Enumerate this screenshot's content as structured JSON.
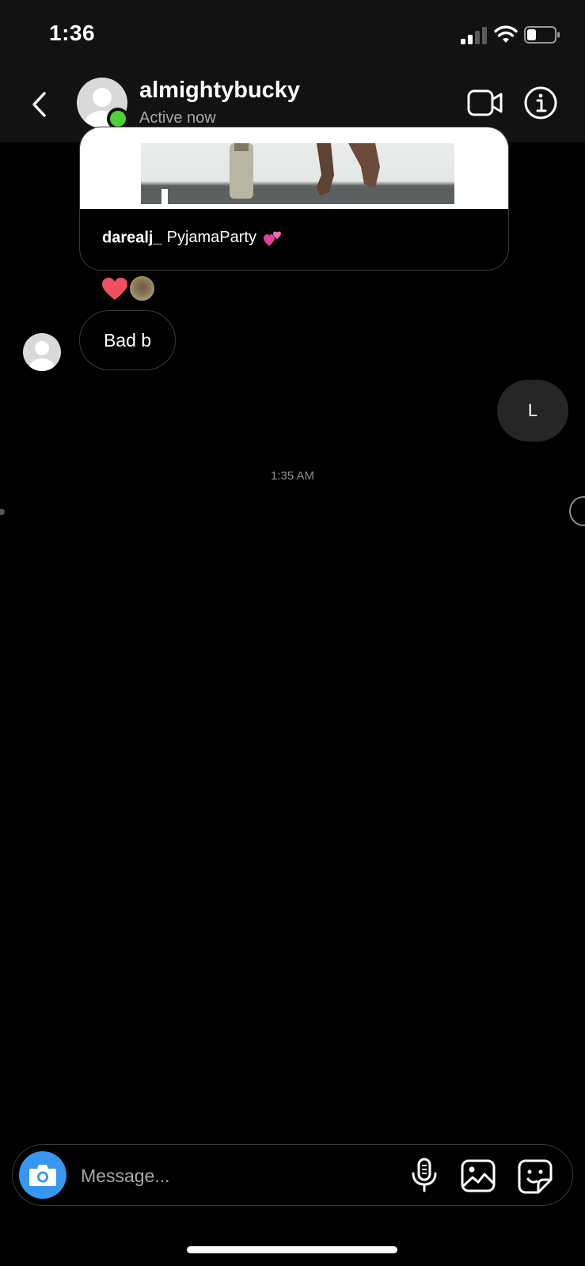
{
  "status_bar": {
    "time": "1:36",
    "icons": [
      "cellular-signal-icon",
      "wifi-icon",
      "battery-icon"
    ]
  },
  "header": {
    "username": "almightybucky",
    "status": "Active now",
    "online_color": "#4cd137",
    "icons": [
      "back-chevron-icon",
      "video-call-icon",
      "info-icon"
    ]
  },
  "conversation": {
    "shared_post": {
      "author": "darealj_",
      "caption": "PyjamaParty",
      "emoji": "pink-hearts-emoji"
    },
    "reactions": [
      "heart-icon",
      "reactor-avatar"
    ],
    "messages": [
      {
        "direction": "incoming",
        "text": "Bad b"
      },
      {
        "direction": "outgoing",
        "text": "L"
      }
    ],
    "timestamp": "1:35 AM"
  },
  "composer": {
    "placeholder": "Message...",
    "accent_color": "#3797f0",
    "icons": [
      "camera-icon",
      "microphone-icon",
      "gallery-icon",
      "sticker-icon"
    ]
  }
}
